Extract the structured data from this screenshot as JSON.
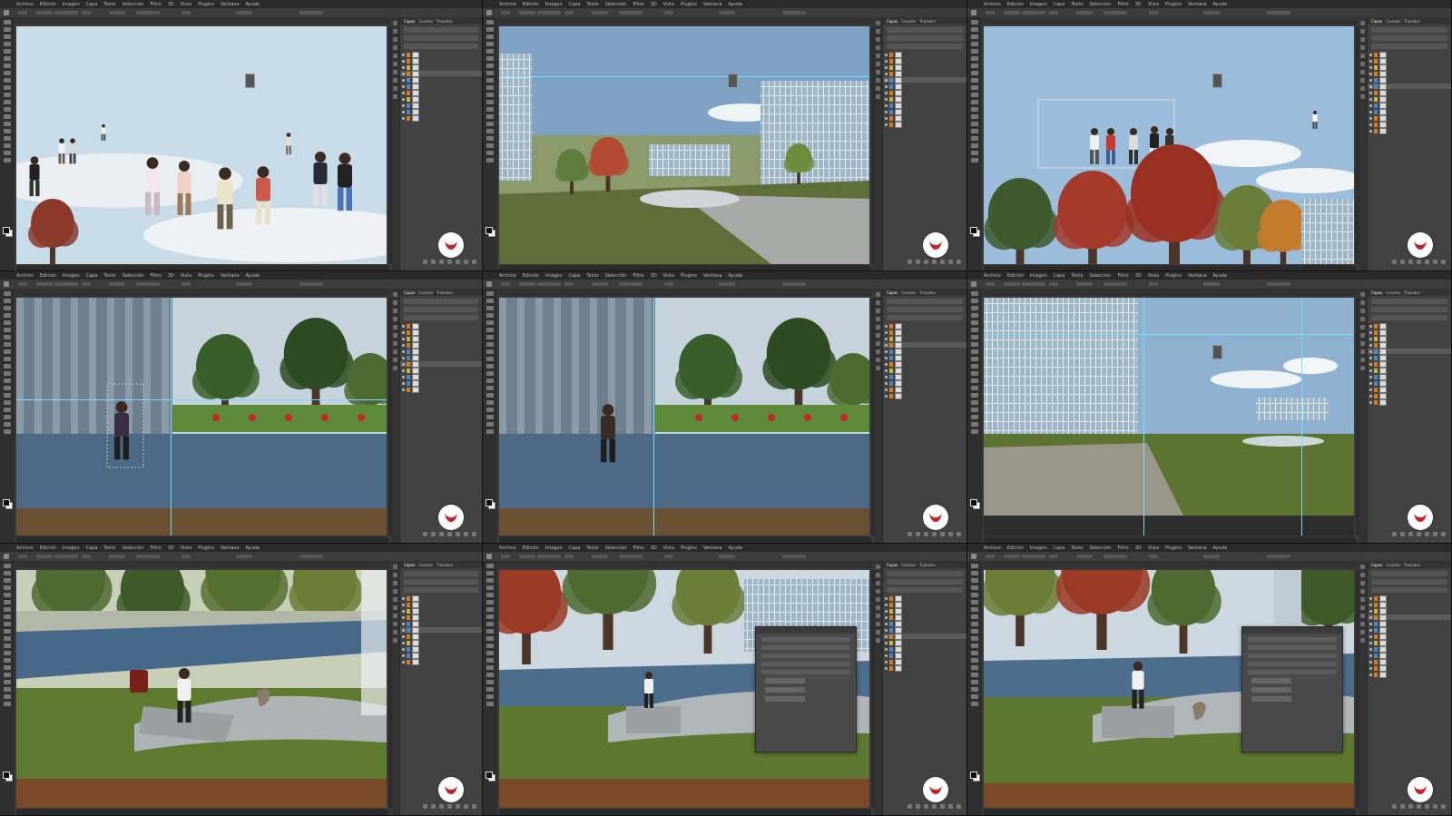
{
  "menu": [
    "Archivo",
    "Edición",
    "Imagen",
    "Capa",
    "Texto",
    "Selección",
    "Filtro",
    "3D",
    "Vista",
    "Plugins",
    "Ventana",
    "Ayuda"
  ],
  "panel_tabs": [
    "Capas",
    "Canales",
    "Trazados"
  ],
  "icons": {
    "brand": "logo-icon",
    "visibility": "eye-icon"
  },
  "colors": {
    "brand_red": "#c0272d",
    "photoshop_bg": "#3a3a3a",
    "panel_bg": "#424242",
    "layer_orange": "#d97a1e",
    "layer_yellow": "#c9b23a",
    "layer_blue": "#4a86c6",
    "guide": "#78dcff"
  }
}
